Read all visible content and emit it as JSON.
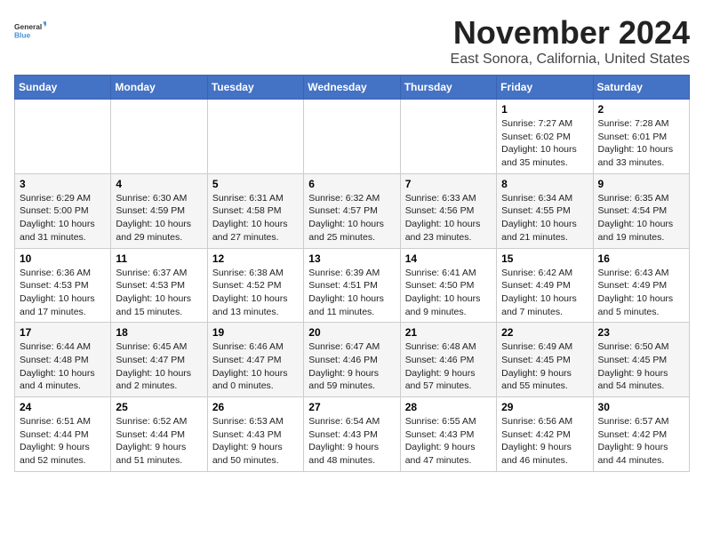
{
  "logo": {
    "general": "General",
    "blue": "Blue"
  },
  "title": "November 2024",
  "location": "East Sonora, California, United States",
  "days_of_week": [
    "Sunday",
    "Monday",
    "Tuesday",
    "Wednesday",
    "Thursday",
    "Friday",
    "Saturday"
  ],
  "weeks": [
    [
      {
        "day": "",
        "info": ""
      },
      {
        "day": "",
        "info": ""
      },
      {
        "day": "",
        "info": ""
      },
      {
        "day": "",
        "info": ""
      },
      {
        "day": "",
        "info": ""
      },
      {
        "day": "1",
        "info": "Sunrise: 7:27 AM\nSunset: 6:02 PM\nDaylight: 10 hours and 35 minutes."
      },
      {
        "day": "2",
        "info": "Sunrise: 7:28 AM\nSunset: 6:01 PM\nDaylight: 10 hours and 33 minutes."
      }
    ],
    [
      {
        "day": "3",
        "info": "Sunrise: 6:29 AM\nSunset: 5:00 PM\nDaylight: 10 hours and 31 minutes."
      },
      {
        "day": "4",
        "info": "Sunrise: 6:30 AM\nSunset: 4:59 PM\nDaylight: 10 hours and 29 minutes."
      },
      {
        "day": "5",
        "info": "Sunrise: 6:31 AM\nSunset: 4:58 PM\nDaylight: 10 hours and 27 minutes."
      },
      {
        "day": "6",
        "info": "Sunrise: 6:32 AM\nSunset: 4:57 PM\nDaylight: 10 hours and 25 minutes."
      },
      {
        "day": "7",
        "info": "Sunrise: 6:33 AM\nSunset: 4:56 PM\nDaylight: 10 hours and 23 minutes."
      },
      {
        "day": "8",
        "info": "Sunrise: 6:34 AM\nSunset: 4:55 PM\nDaylight: 10 hours and 21 minutes."
      },
      {
        "day": "9",
        "info": "Sunrise: 6:35 AM\nSunset: 4:54 PM\nDaylight: 10 hours and 19 minutes."
      }
    ],
    [
      {
        "day": "10",
        "info": "Sunrise: 6:36 AM\nSunset: 4:53 PM\nDaylight: 10 hours and 17 minutes."
      },
      {
        "day": "11",
        "info": "Sunrise: 6:37 AM\nSunset: 4:53 PM\nDaylight: 10 hours and 15 minutes."
      },
      {
        "day": "12",
        "info": "Sunrise: 6:38 AM\nSunset: 4:52 PM\nDaylight: 10 hours and 13 minutes."
      },
      {
        "day": "13",
        "info": "Sunrise: 6:39 AM\nSunset: 4:51 PM\nDaylight: 10 hours and 11 minutes."
      },
      {
        "day": "14",
        "info": "Sunrise: 6:41 AM\nSunset: 4:50 PM\nDaylight: 10 hours and 9 minutes."
      },
      {
        "day": "15",
        "info": "Sunrise: 6:42 AM\nSunset: 4:49 PM\nDaylight: 10 hours and 7 minutes."
      },
      {
        "day": "16",
        "info": "Sunrise: 6:43 AM\nSunset: 4:49 PM\nDaylight: 10 hours and 5 minutes."
      }
    ],
    [
      {
        "day": "17",
        "info": "Sunrise: 6:44 AM\nSunset: 4:48 PM\nDaylight: 10 hours and 4 minutes."
      },
      {
        "day": "18",
        "info": "Sunrise: 6:45 AM\nSunset: 4:47 PM\nDaylight: 10 hours and 2 minutes."
      },
      {
        "day": "19",
        "info": "Sunrise: 6:46 AM\nSunset: 4:47 PM\nDaylight: 10 hours and 0 minutes."
      },
      {
        "day": "20",
        "info": "Sunrise: 6:47 AM\nSunset: 4:46 PM\nDaylight: 9 hours and 59 minutes."
      },
      {
        "day": "21",
        "info": "Sunrise: 6:48 AM\nSunset: 4:46 PM\nDaylight: 9 hours and 57 minutes."
      },
      {
        "day": "22",
        "info": "Sunrise: 6:49 AM\nSunset: 4:45 PM\nDaylight: 9 hours and 55 minutes."
      },
      {
        "day": "23",
        "info": "Sunrise: 6:50 AM\nSunset: 4:45 PM\nDaylight: 9 hours and 54 minutes."
      }
    ],
    [
      {
        "day": "24",
        "info": "Sunrise: 6:51 AM\nSunset: 4:44 PM\nDaylight: 9 hours and 52 minutes."
      },
      {
        "day": "25",
        "info": "Sunrise: 6:52 AM\nSunset: 4:44 PM\nDaylight: 9 hours and 51 minutes."
      },
      {
        "day": "26",
        "info": "Sunrise: 6:53 AM\nSunset: 4:43 PM\nDaylight: 9 hours and 50 minutes."
      },
      {
        "day": "27",
        "info": "Sunrise: 6:54 AM\nSunset: 4:43 PM\nDaylight: 9 hours and 48 minutes."
      },
      {
        "day": "28",
        "info": "Sunrise: 6:55 AM\nSunset: 4:43 PM\nDaylight: 9 hours and 47 minutes."
      },
      {
        "day": "29",
        "info": "Sunrise: 6:56 AM\nSunset: 4:42 PM\nDaylight: 9 hours and 46 minutes."
      },
      {
        "day": "30",
        "info": "Sunrise: 6:57 AM\nSunset: 4:42 PM\nDaylight: 9 hours and 44 minutes."
      }
    ]
  ]
}
